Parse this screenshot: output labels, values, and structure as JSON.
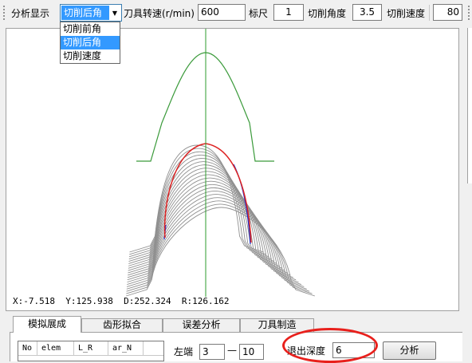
{
  "toolbar": {
    "analysis_label": "分析显示",
    "analysis_selected": "切削后角",
    "analysis_options": [
      "切削前角",
      "切削后角",
      "切削速度"
    ],
    "spindle_speed_label": "刀具转速(r/min)",
    "spindle_speed_value": "600",
    "scale_label": "标尺",
    "scale_value": "1",
    "cut_angle_label": "切削角度",
    "cut_angle_value": "3.5",
    "cut_speed_label": "切削速度",
    "cut_speed_value": "80"
  },
  "plot": {
    "coords_readout": "X:-7.518  Y:125.938  D:252.324  R:126.162",
    "colors": {
      "axis_line": "#2e9b2e",
      "profile_curve": "#3a9a3a",
      "envelope": "#dd2222",
      "envelope_edge": "#2233cc",
      "generating_curves": "#909090"
    }
  },
  "tabs": [
    "模拟展成",
    "齿形拟合",
    "误差分析",
    "刀具制造"
  ],
  "active_tab": "模拟展成",
  "table": {
    "columns": [
      "No",
      "elem",
      "L_R",
      "ar_N"
    ]
  },
  "controls": {
    "left_end_label": "左端",
    "left_end_from": "3",
    "range_dash": "—",
    "left_end_to": "10",
    "exit_depth_label": "退出深度",
    "exit_depth_value": "6",
    "analyze_button": "分析"
  }
}
